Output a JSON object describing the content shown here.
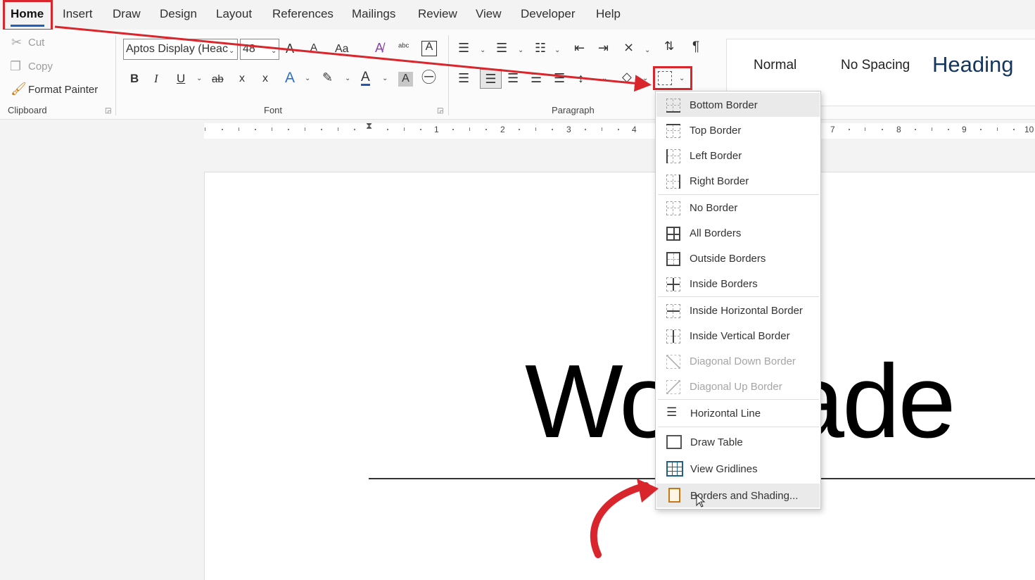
{
  "tabs": [
    "Home",
    "Insert",
    "Draw",
    "Design",
    "Layout",
    "References",
    "Mailings",
    "Review",
    "View",
    "Developer",
    "Help"
  ],
  "clipboard": {
    "cut": "Cut",
    "copy": "Copy",
    "format_painter": "Format Painter",
    "label": "Clipboard"
  },
  "font": {
    "name": "Aptos Display (Heac",
    "size": "48",
    "label": "Font",
    "bold": "B",
    "italic": "I",
    "underline": "U",
    "strike": "ab",
    "subscript": "x",
    "superscript": "x",
    "grow": "A",
    "shrink": "A",
    "case": "Aa",
    "effects": "A",
    "color": "A",
    "shade": "A"
  },
  "paragraph": {
    "label": "Paragraph"
  },
  "styles": {
    "normal": "Normal",
    "no_spacing": "No Spacing",
    "heading": "Heading"
  },
  "ruler": [
    "1",
    "2",
    "3",
    "4",
    "7",
    "8",
    "9",
    "10"
  ],
  "document": {
    "text": "Wo      Made"
  },
  "borders_menu": {
    "items": [
      {
        "label": "Bottom Border",
        "icon": "bottom-border-icon"
      },
      {
        "label": "Top Border",
        "icon": "top-border-icon"
      },
      {
        "label": "Left Border",
        "icon": "left-border-icon"
      },
      {
        "label": "Right Border",
        "icon": "right-border-icon"
      },
      {
        "label": "No Border",
        "icon": "no-border-icon"
      },
      {
        "label": "All Borders",
        "icon": "all-borders-icon"
      },
      {
        "label": "Outside Borders",
        "icon": "outside-borders-icon"
      },
      {
        "label": "Inside Borders",
        "icon": "inside-borders-icon"
      },
      {
        "label": "Inside Horizontal Border",
        "icon": "inside-horizontal-border-icon"
      },
      {
        "label": "Inside Vertical Border",
        "icon": "inside-vertical-border-icon"
      },
      {
        "label": "Diagonal Down Border",
        "icon": "diagonal-down-border-icon"
      },
      {
        "label": "Diagonal Up Border",
        "icon": "diagonal-up-border-icon"
      },
      {
        "label": "Horizontal Line",
        "icon": "horizontal-line-icon"
      },
      {
        "label": "Draw Table",
        "icon": "draw-table-icon"
      },
      {
        "label": "View Gridlines",
        "icon": "view-gridlines-icon"
      },
      {
        "label": "Borders and Shading...",
        "icon": "borders-shading-icon"
      }
    ]
  },
  "colors": {
    "highlight_box": "#d9262c",
    "accent": "#1f5fbf"
  }
}
